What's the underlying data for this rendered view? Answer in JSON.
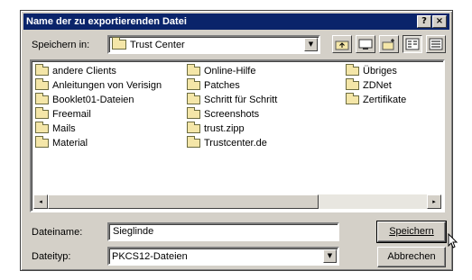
{
  "window": {
    "title": "Name der zu exportierenden Datei"
  },
  "titlebar_buttons": {
    "help": "?",
    "close": "×"
  },
  "save_in": {
    "label": "Speichern in:",
    "value": "Trust Center"
  },
  "toolbar": {
    "icons": [
      "up-folder-icon",
      "desktop-icon",
      "new-folder-icon",
      "list-view-icon",
      "details-view-icon"
    ]
  },
  "files": {
    "col1": [
      "andere Clients",
      "Anleitungen von Verisign",
      "Booklet01-Dateien",
      "Freemail",
      "Mails",
      "Material"
    ],
    "col2": [
      "Online-Hilfe",
      "Patches",
      "Schritt für Schritt",
      "Screenshots",
      "trust.zipp",
      "Trustcenter.de"
    ],
    "col3": [
      "Übriges",
      "ZDNet",
      "Zertifikate"
    ]
  },
  "filename": {
    "label": "Dateiname:",
    "value": "Sieglinde"
  },
  "filetype": {
    "label": "Dateityp:",
    "value": "PKCS12-Dateien"
  },
  "buttons": {
    "save": "Speichern",
    "cancel": "Abbrechen"
  },
  "scrollbar": {
    "left": "◂",
    "right": "▸"
  }
}
